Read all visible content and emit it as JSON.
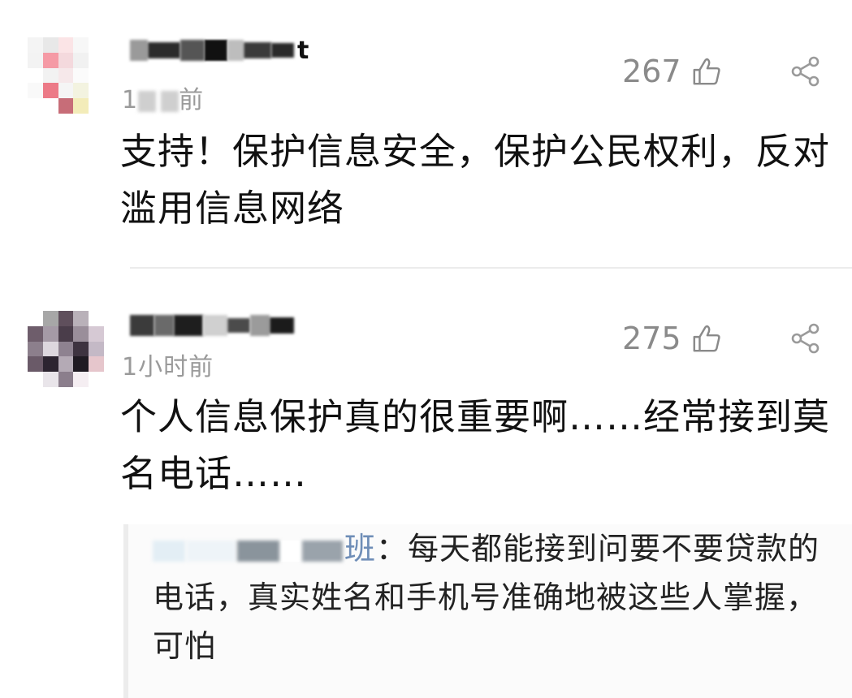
{
  "comments": [
    {
      "username_tail": "t",
      "time": "1周前",
      "time_visible_prefix": "1",
      "time_visible_suffix": "前",
      "likes": "267",
      "text": "支持！保护信息安全，保护公民权利，反对滥用信息网络"
    },
    {
      "username_tail": "",
      "time": "1小时前",
      "likes": "275",
      "text": "个人信息保护真的很重要啊……经常接到莫名电话……",
      "reply": {
        "author_suffix": "班",
        "separator": "：",
        "text": "每天都能接到问要不要贷款的电话，真实姓名和手机号准确地被这些人掌握，可怕"
      }
    }
  ],
  "icons": {
    "like": "thumbs-up-outline-icon",
    "share": "share-nodes-icon"
  },
  "colors": {
    "meta_text": "#9a9a9a",
    "like_text": "#8a8a8a",
    "body_text": "#111111",
    "reply_author": "#6e8db7",
    "divider": "#ececec"
  }
}
